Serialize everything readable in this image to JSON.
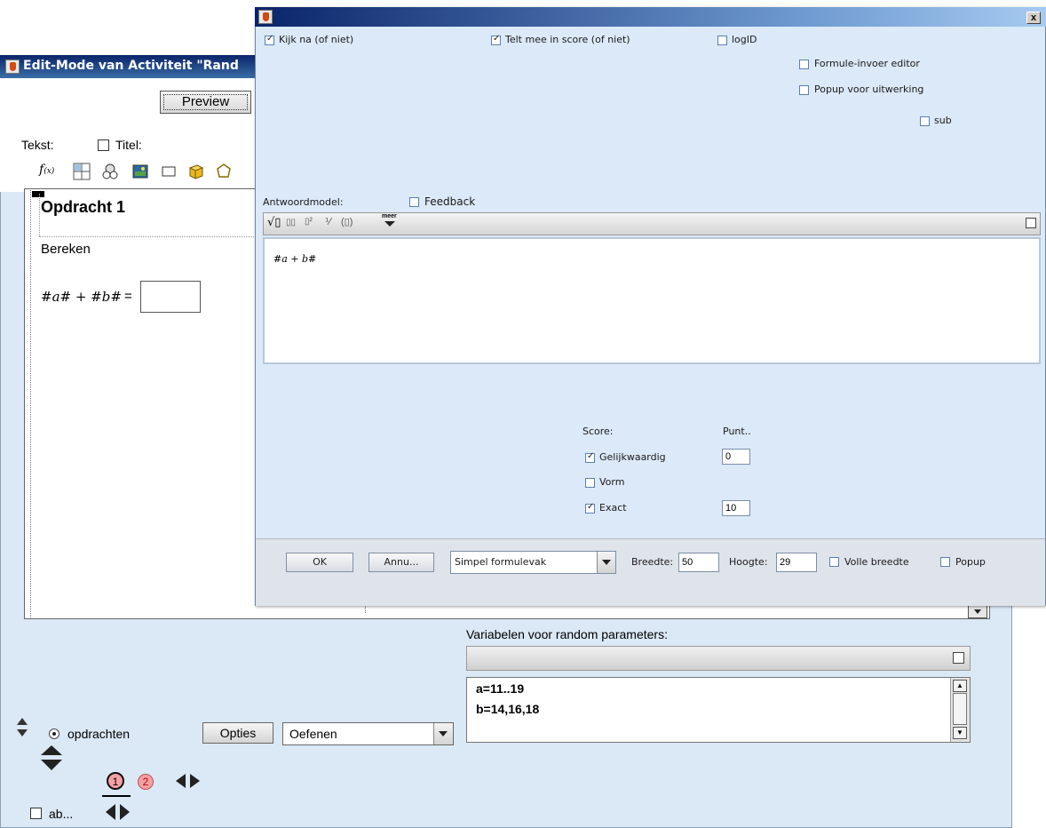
{
  "back_window": {
    "title": "Edit-Mode van Activiteit \"Rand",
    "preview_label": "Preview",
    "tekst_label": "Tekst:",
    "titel_label": "Titel:",
    "editor": {
      "heading": "Opdracht 1",
      "instruction": "Bereken",
      "formula": "#a# + #b#",
      "equals": "="
    },
    "variables": {
      "label": "Variabelen voor random parameters:",
      "lines": [
        "a=11..19",
        "b=14,16,18"
      ]
    },
    "opdrachten_label": "opdrachten",
    "opties_label": "Opties",
    "mode_select": "Oefenen",
    "pages": [
      "1",
      "2"
    ],
    "ab_label": "ab..."
  },
  "dialog": {
    "checkboxes": {
      "kijk_na": "Kijk na (of niet)",
      "telt_mee": "Telt mee in score (of niet)",
      "logid": "logID",
      "formule_invoer": "Formule-invoer editor",
      "popup_uitwerking": "Popup voor uitwerking",
      "sub": "sub",
      "feedback": "Feedback"
    },
    "antwoordmodel_label": "Antwoordmodel:",
    "formula_toolbar_more": "meer",
    "answer_formula": "#a + b#",
    "score": {
      "score_label": "Score:",
      "punt_label": "Punt..",
      "rows": [
        {
          "label": "Gelijkwaardig",
          "checked": true,
          "punt": "0"
        },
        {
          "label": "Vorm",
          "checked": false,
          "punt": ""
        },
        {
          "label": "Exact",
          "checked": true,
          "punt": "10"
        }
      ]
    },
    "bottom": {
      "ok_label": "OK",
      "annu_label": "Annu...",
      "type_select": "Simpel formulevak",
      "breedte_label": "Breedte:",
      "breedte_value": "50",
      "hoogte_label": "Hoogte:",
      "hoogte_value": "29",
      "volle_breedte_label": "Volle breedte",
      "popup_label": "Popup"
    },
    "close_glyph": "x"
  },
  "colors": {
    "panel_bg": "#dbe8f5",
    "titlebar": "#0a246a",
    "page_badge": "#f4a0a4"
  }
}
